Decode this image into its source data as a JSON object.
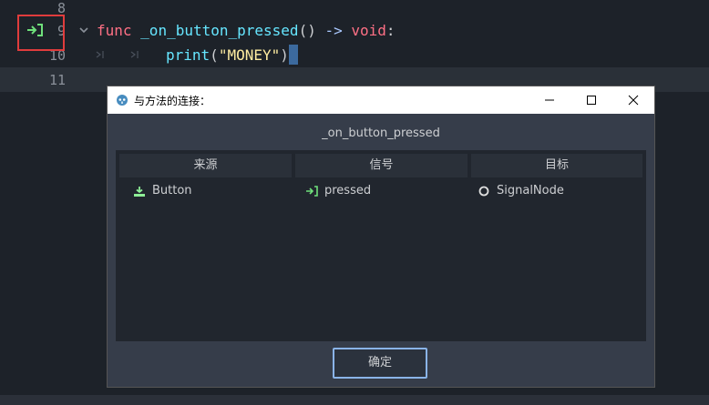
{
  "editor": {
    "lines": [
      {
        "num": "8"
      },
      {
        "num": "9"
      },
      {
        "num": "10"
      },
      {
        "num": "11"
      }
    ],
    "line9": {
      "kw": "func",
      "name": "_on_button_pressed",
      "parens": "()",
      "arrow": "->",
      "ret": "void",
      "colon": ":"
    },
    "line10": {
      "fn": "print",
      "open": "(",
      "str": "\"MONEY\"",
      "close": ")"
    }
  },
  "dialog": {
    "title": "与方法的连接：",
    "method": "_on_button_pressed",
    "columns": [
      "来源",
      "信号",
      "目标"
    ],
    "row": {
      "source": "Button",
      "signal": "pressed",
      "target": "SignalNode"
    },
    "ok_label": "确定"
  },
  "colors": {
    "signal_green": "#6fe07b",
    "highlight_red": "#e03c3c",
    "button_border": "#8ab4e8"
  }
}
